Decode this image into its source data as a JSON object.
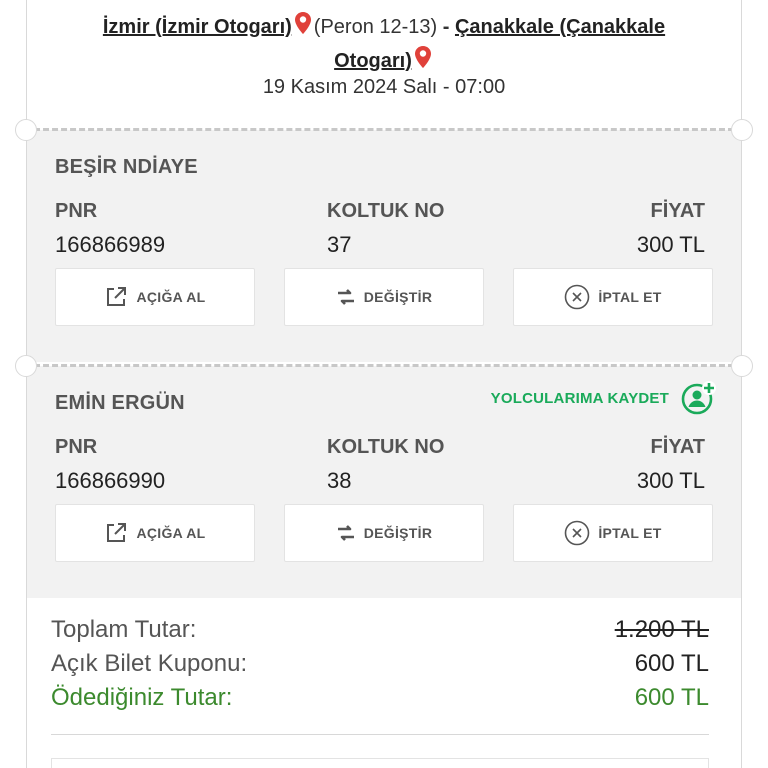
{
  "trip": {
    "from_city": "İzmir (İzmir Otogarı)",
    "from_platform": "(Peron 12-13)",
    "separator": " - ",
    "to_city": "Çanakkale (Çanakkale Otogarı)",
    "date_time": "19 Kasım 2024 Salı - 07:00"
  },
  "labels": {
    "pnr": "PNR",
    "seat": "KOLTUK NO",
    "price": "FİYAT",
    "release": "AÇIĞA AL",
    "change": "DEĞİŞTİR",
    "cancel": "İPTAL ET",
    "save_passenger": "YOLCULARIMA KAYDET"
  },
  "passengers": [
    {
      "name": "BEŞİR NDİAYE",
      "pnr": "166866989",
      "seat": "37",
      "price": "300 TL"
    },
    {
      "name": "EMİN ERGÜN",
      "pnr": "166866990",
      "seat": "38",
      "price": "300 TL"
    }
  ],
  "summary": {
    "total_label": "Toplam Tutar:",
    "total_value": "1.200 TL",
    "coupon_label": "Açık Bilet Kuponu:",
    "coupon_value": "600 TL",
    "paid_label": "Ödediğiniz Tutar:",
    "paid_value": "600 TL"
  },
  "colors": {
    "accent_green": "#1aaa5a",
    "paid_green": "#3c8a2e",
    "pin_red": "#e0413a"
  },
  "icons": [
    "location-pin-icon",
    "external-link-icon",
    "swap-arrows-icon",
    "cancel-circle-x-icon",
    "add-user-icon"
  ]
}
